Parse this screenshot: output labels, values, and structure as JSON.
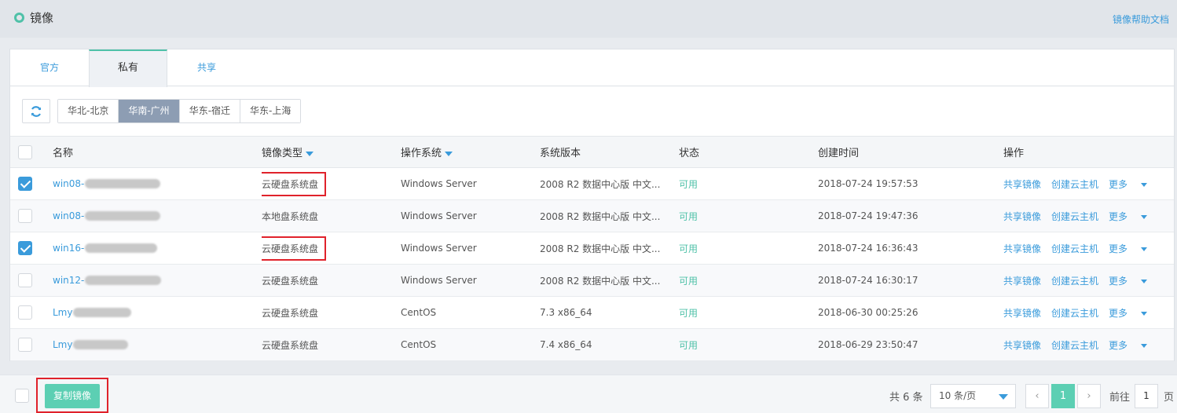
{
  "header": {
    "title": "镜像",
    "help_link": "镜像帮助文档"
  },
  "tabs": [
    {
      "label": "官方",
      "active": false
    },
    {
      "label": "私有",
      "active": true
    },
    {
      "label": "共享",
      "active": false
    }
  ],
  "toolbar": {
    "refresh_icon": "refresh-icon",
    "regions": [
      {
        "label": "华北-北京",
        "active": false
      },
      {
        "label": "华南-广州",
        "active": true
      },
      {
        "label": "华东-宿迁",
        "active": false
      },
      {
        "label": "华东-上海",
        "active": false
      }
    ]
  },
  "table": {
    "columns": [
      "名称",
      "镜像类型",
      "操作系统",
      "系统版本",
      "状态",
      "创建时间",
      "操作"
    ],
    "rows": [
      {
        "checked": true,
        "name": "win08-",
        "type": "云硬盘系统盘",
        "os": "Windows Server",
        "version": "2008 R2 数据中心版 中文...",
        "status": "可用",
        "created": "2018-07-24 19:57:53"
      },
      {
        "checked": false,
        "name": "win08-",
        "type": "本地盘系统盘",
        "os": "Windows Server",
        "version": "2008 R2 数据中心版 中文...",
        "status": "可用",
        "created": "2018-07-24 19:47:36"
      },
      {
        "checked": true,
        "name": "win16-",
        "type": "云硬盘系统盘",
        "os": "Windows Server",
        "version": "2008 R2 数据中心版 中文...",
        "status": "可用",
        "created": "2018-07-24 16:36:43"
      },
      {
        "checked": false,
        "name": "win12-",
        "type": "云硬盘系统盘",
        "os": "Windows Server",
        "version": "2008 R2 数据中心版 中文...",
        "status": "可用",
        "created": "2018-07-24 16:30:17"
      },
      {
        "checked": false,
        "name": "Lmy",
        "type": "云硬盘系统盘",
        "os": "CentOS",
        "version": "7.3 x86_64",
        "status": "可用",
        "created": "2018-06-30 00:25:26"
      },
      {
        "checked": false,
        "name": "Lmy",
        "type": "云硬盘系统盘",
        "os": "CentOS",
        "version": "7.4 x86_64",
        "status": "可用",
        "created": "2018-06-29 23:50:47"
      }
    ],
    "actions": {
      "share": "共享镜像",
      "create": "创建云主机",
      "more": "更多"
    }
  },
  "footer": {
    "copy_button": "复制镜像",
    "total": "共 6 条",
    "page_size": "10 条/页",
    "prev": "‹",
    "current_page": "1",
    "next": "›",
    "goto_label": "前往",
    "goto_value": "1",
    "page_suffix": "页"
  },
  "colors": {
    "accent": "#4fc1a8",
    "link": "#3a9bdb",
    "highlight": "#e0222b"
  }
}
